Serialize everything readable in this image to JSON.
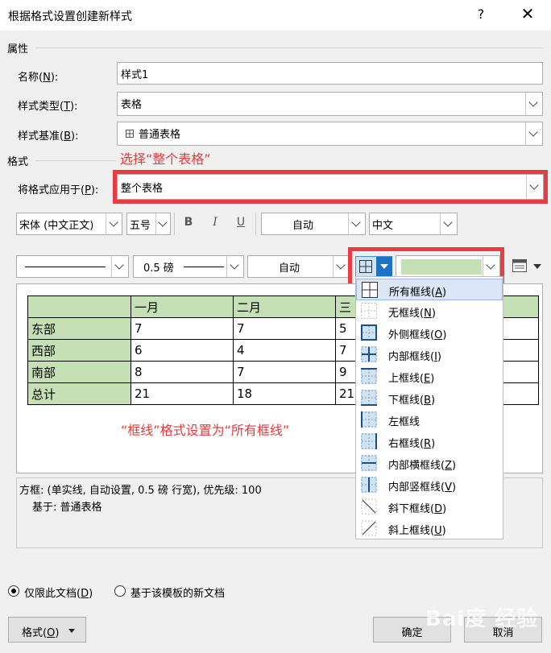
{
  "dialog": {
    "title": "根据格式设置创建新样式",
    "help_icon": "?",
    "close_icon": "✕"
  },
  "properties": {
    "section_label": "属性",
    "name": {
      "label": "名称(",
      "key": "N",
      "suffix": "):",
      "value": "样式1"
    },
    "style_type": {
      "label": "样式类型(",
      "key": "T",
      "suffix": "):",
      "value": "表格"
    },
    "based_on": {
      "label": "样式基准(",
      "key": "B",
      "suffix": "):",
      "value": "普通表格"
    }
  },
  "formatting": {
    "section_label": "格式",
    "annotation_select": "选择“整个表格”",
    "apply_to": {
      "label": "将格式应用于(",
      "key": "P",
      "suffix": "):",
      "value": "整个表格"
    },
    "font": "宋体 (中文正文)",
    "size": "五号",
    "bold": "B",
    "italic": "I",
    "underline": "U",
    "font_color": "自动",
    "script": "中文",
    "line_width": "0.5 磅",
    "border_color": "自动",
    "shading_color": "#c5e0b4",
    "accent_red": "#e93d44"
  },
  "preview": {
    "header": [
      "",
      "一月",
      "二月",
      "三"
    ],
    "rows": [
      [
        "东部",
        "7",
        "7",
        "5"
      ],
      [
        "西部",
        "6",
        "4",
        "7"
      ],
      [
        "南部",
        "8",
        "7",
        "9"
      ],
      [
        "总计",
        "21",
        "18",
        "21"
      ]
    ],
    "annotation": "“框线”格式设置为“所有框线”"
  },
  "border_menu": {
    "items": [
      {
        "label": "所有框线(",
        "key": "A",
        "icon": "all-borders-icon"
      },
      {
        "label": "无框线(",
        "key": "N",
        "icon": "no-border-icon"
      },
      {
        "label": "外侧框线(",
        "key": "O",
        "icon": "outside-borders-icon"
      },
      {
        "label": "内部框线(",
        "key": "I",
        "icon": "inside-borders-icon"
      },
      {
        "label": "上框线(",
        "key": "E",
        "icon": "top-border-icon"
      },
      {
        "label": "下框线(",
        "key": "B",
        "icon": "bottom-border-icon"
      },
      {
        "label": "左框线",
        "key": "",
        "icon": "left-border-icon"
      },
      {
        "label": "右框线(",
        "key": "R",
        "icon": "right-border-icon"
      },
      {
        "label": "内部横框线(",
        "key": "Z",
        "icon": "inside-horizontal-border-icon"
      },
      {
        "label": "内部竖框线(",
        "key": "V",
        "icon": "inside-vertical-border-icon"
      },
      {
        "label": "斜下框线(",
        "key": "D",
        "icon": "diagonal-down-border-icon"
      },
      {
        "label": "斜上框线(",
        "key": "U",
        "icon": "diagonal-up-border-icon"
      }
    ]
  },
  "description": {
    "line1": "方框: (单实线, 自动设置, 0.5 磅 行宽), 优先级: 100",
    "line2": "基于: 普通表格"
  },
  "scope": {
    "only_this_doc": {
      "label": "仅限此文档(",
      "key": "D",
      "suffix": ")"
    },
    "new_docs": "基于该模板的新文档"
  },
  "buttons": {
    "format": {
      "label": "格式(",
      "key": "O",
      "suffix": ")"
    },
    "ok": "确定",
    "cancel": "取消"
  },
  "watermark": "Bai度 经验"
}
